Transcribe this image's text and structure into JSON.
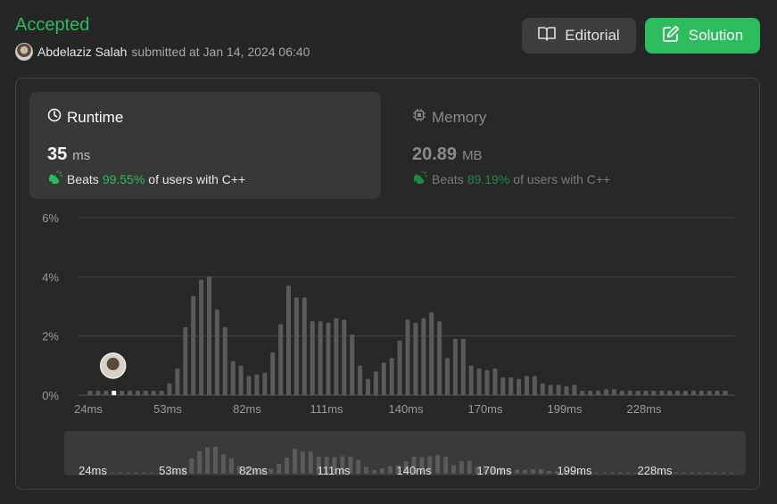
{
  "header": {
    "status": "Accepted",
    "user_name": "Abdelaziz Salah",
    "submitted_text": "submitted at Jan 14, 2024 06:40"
  },
  "buttons": {
    "editorial": "Editorial",
    "solution": "Solution"
  },
  "runtime": {
    "title": "Runtime",
    "value": "35",
    "unit": "ms",
    "beats_label": "Beats",
    "beats_pct": "99.55%",
    "beats_suffix": "of users with C++"
  },
  "memory": {
    "title": "Memory",
    "value": "20.89",
    "unit": "MB",
    "beats_label": "Beats",
    "beats_pct": "89.19%",
    "beats_suffix": "of users with C++"
  },
  "colors": {
    "accent_green": "#2cbb5d",
    "bar": "#5a5a5a",
    "bar_highlight": "#ffffff"
  },
  "chart_data": {
    "type": "bar",
    "ylim": [
      0,
      6
    ],
    "y_ticks": [
      "0%",
      "2%",
      "4%",
      "6%"
    ],
    "x_tick_labels": [
      "24ms",
      "53ms",
      "82ms",
      "111ms",
      "140ms",
      "170ms",
      "199ms",
      "228ms"
    ],
    "highlight_index": 3,
    "values": [
      0.15,
      0.15,
      0.15,
      0.15,
      0.15,
      0.15,
      0.15,
      0.15,
      0.15,
      0.15,
      0.4,
      0.9,
      2.3,
      3.35,
      3.9,
      4.0,
      2.9,
      2.3,
      1.15,
      1.0,
      0.65,
      0.7,
      0.75,
      1.45,
      2.4,
      3.7,
      3.3,
      3.3,
      2.5,
      2.5,
      2.45,
      2.6,
      2.55,
      2.05,
      1.0,
      0.55,
      0.8,
      1.1,
      1.25,
      1.85,
      2.55,
      2.45,
      2.6,
      2.8,
      2.5,
      1.25,
      1.9,
      1.9,
      1.0,
      0.9,
      0.85,
      0.9,
      0.6,
      0.6,
      0.55,
      0.65,
      0.65,
      0.4,
      0.35,
      0.35,
      0.3,
      0.35,
      0.15,
      0.15,
      0.15,
      0.2,
      0.2,
      0.15,
      0.15,
      0.15,
      0.15,
      0.15,
      0.15,
      0.15,
      0.15,
      0.15,
      0.15,
      0.15,
      0.15,
      0.15,
      0.15
    ]
  }
}
